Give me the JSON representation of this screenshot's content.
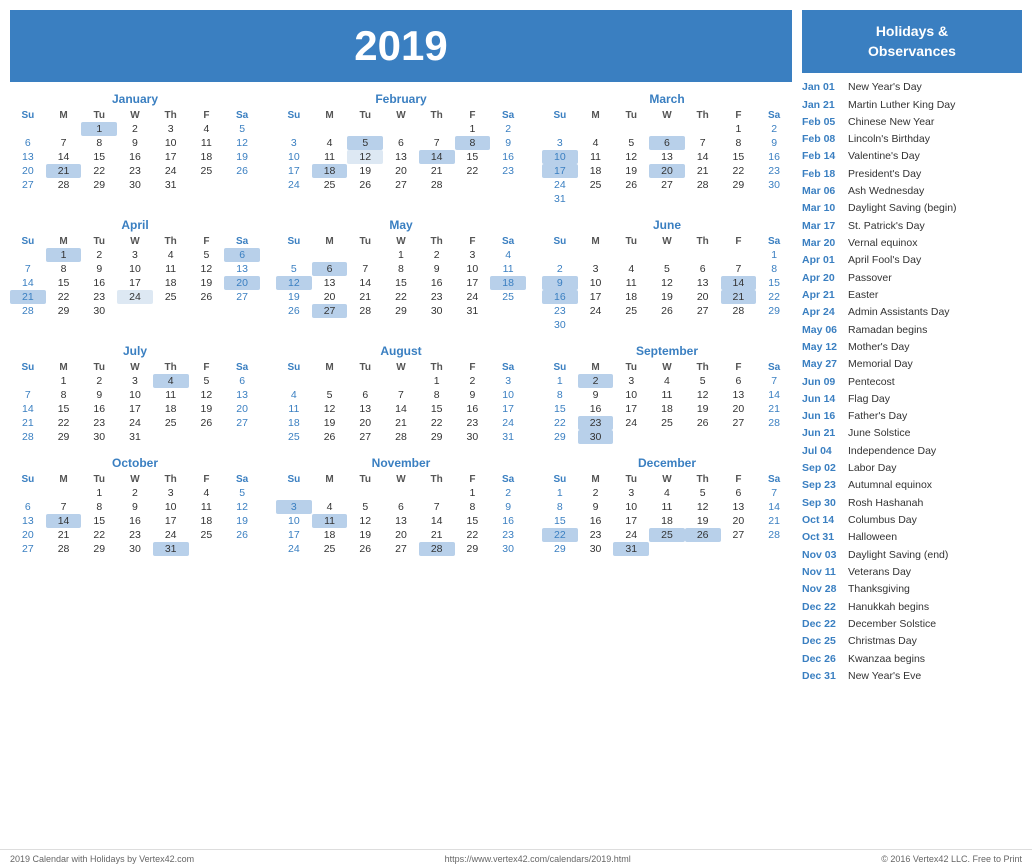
{
  "header": {
    "year": "2019"
  },
  "sidebar": {
    "title": "Holidays &\nObservances",
    "holidays": [
      {
        "date": "Jan 01",
        "name": "New Year's Day"
      },
      {
        "date": "Jan 21",
        "name": "Martin Luther King Day"
      },
      {
        "date": "Feb 05",
        "name": "Chinese New Year"
      },
      {
        "date": "Feb 08",
        "name": "Lincoln's Birthday"
      },
      {
        "date": "Feb 14",
        "name": "Valentine's Day"
      },
      {
        "date": "Feb 18",
        "name": "President's Day"
      },
      {
        "date": "Mar 06",
        "name": "Ash Wednesday"
      },
      {
        "date": "Mar 10",
        "name": "Daylight Saving (begin)"
      },
      {
        "date": "Mar 17",
        "name": "St. Patrick's Day"
      },
      {
        "date": "Mar 20",
        "name": "Vernal equinox"
      },
      {
        "date": "Apr 01",
        "name": "April Fool's Day"
      },
      {
        "date": "Apr 20",
        "name": "Passover"
      },
      {
        "date": "Apr 21",
        "name": "Easter"
      },
      {
        "date": "Apr 24",
        "name": "Admin Assistants Day"
      },
      {
        "date": "May 06",
        "name": "Ramadan begins"
      },
      {
        "date": "May 12",
        "name": "Mother's Day"
      },
      {
        "date": "May 27",
        "name": "Memorial Day"
      },
      {
        "date": "Jun 09",
        "name": "Pentecost"
      },
      {
        "date": "Jun 14",
        "name": "Flag Day"
      },
      {
        "date": "Jun 16",
        "name": "Father's Day"
      },
      {
        "date": "Jun 21",
        "name": "June Solstice"
      },
      {
        "date": "Jul 04",
        "name": "Independence Day"
      },
      {
        "date": "Sep 02",
        "name": "Labor Day"
      },
      {
        "date": "Sep 23",
        "name": "Autumnal equinox"
      },
      {
        "date": "Sep 30",
        "name": "Rosh Hashanah"
      },
      {
        "date": "Oct 14",
        "name": "Columbus Day"
      },
      {
        "date": "Oct 31",
        "name": "Halloween"
      },
      {
        "date": "Nov 03",
        "name": "Daylight Saving (end)"
      },
      {
        "date": "Nov 11",
        "name": "Veterans Day"
      },
      {
        "date": "Nov 28",
        "name": "Thanksgiving"
      },
      {
        "date": "Dec 22",
        "name": "Hanukkah begins"
      },
      {
        "date": "Dec 22",
        "name": "December Solstice"
      },
      {
        "date": "Dec 25",
        "name": "Christmas Day"
      },
      {
        "date": "Dec 26",
        "name": "Kwanzaa begins"
      },
      {
        "date": "Dec 31",
        "name": "New Year's Eve"
      }
    ]
  },
  "footer": {
    "left": "2019 Calendar with Holidays by Vertex42.com",
    "center": "https://www.vertex42.com/calendars/2019.html",
    "right": "© 2016 Vertex42 LLC. Free to Print"
  }
}
